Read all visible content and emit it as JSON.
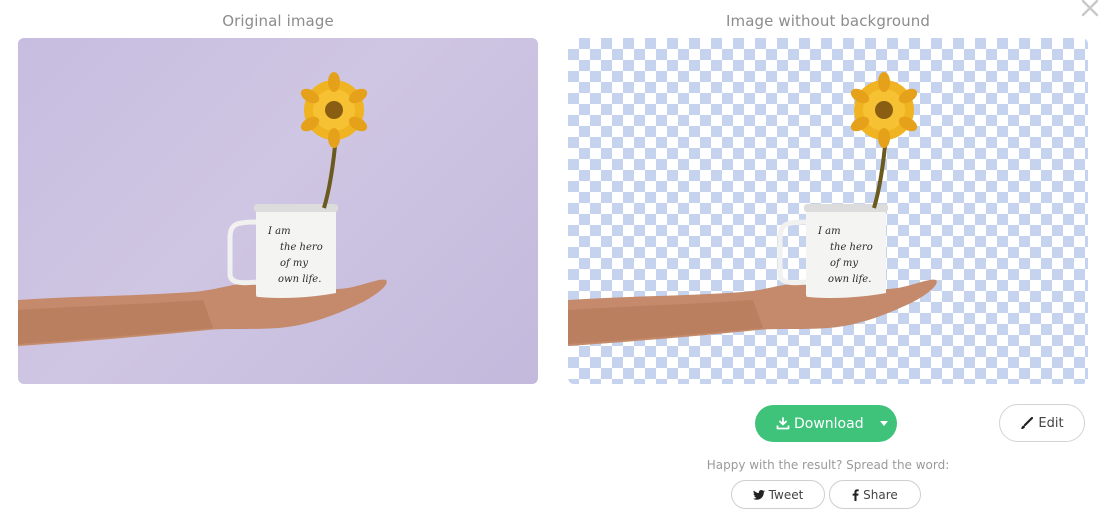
{
  "panels": {
    "original_title": "Original image",
    "result_title": "Image without background"
  },
  "mug": {
    "line1": "I am",
    "line2": "the hero",
    "line3": "of my",
    "line4": "own life."
  },
  "actions": {
    "download_label": "Download",
    "edit_label": "Edit"
  },
  "share": {
    "prompt": "Happy with the result? Spread the word:",
    "tweet_label": "Tweet",
    "share_label": "Share"
  },
  "icons": {
    "close": "close-icon",
    "download": "download-icon",
    "dropdown": "caret-down-icon",
    "edit": "brush-icon",
    "twitter": "twitter-icon",
    "facebook": "facebook-icon"
  },
  "colors": {
    "accent_green": "#3fc27a",
    "original_background": "#cbc1e0",
    "checker_blue": "#c6d3ef"
  }
}
